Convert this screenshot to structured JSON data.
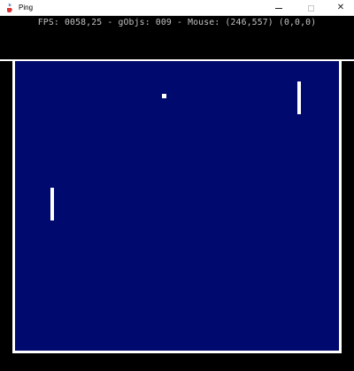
{
  "window": {
    "title": "Ping",
    "app_icon": "java-cup-icon"
  },
  "status": {
    "text": "FPS: 0058,25 - gObjs: 009 - Mouse: (246,557) (0,0,0)"
  },
  "colors": {
    "field": "#000a6e",
    "paddle": "#ffffff",
    "ball": "#ffffff",
    "background": "#000000"
  }
}
